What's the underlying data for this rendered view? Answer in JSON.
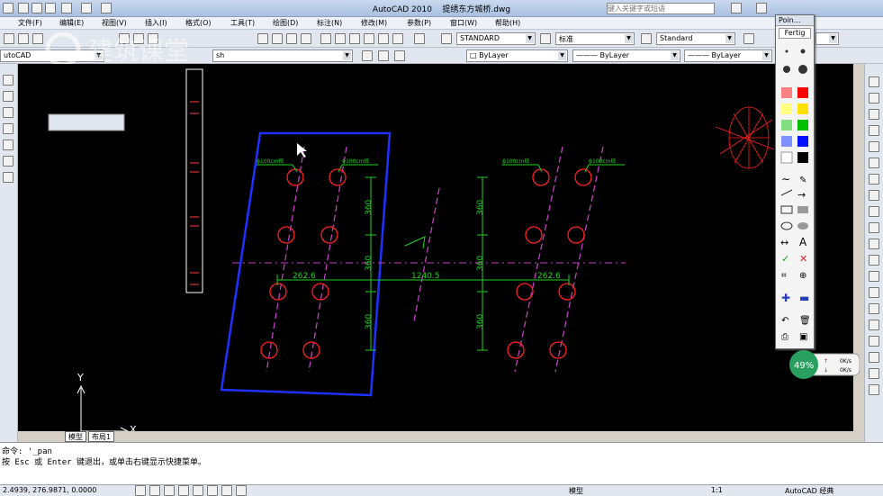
{
  "window": {
    "app": "AutoCAD 2010",
    "file": "提绣东方城桥.dwg",
    "search_placeholder": "键入关键字或短语"
  },
  "menu": [
    "文件(F)",
    "编辑(E)",
    "视图(V)",
    "插入(I)",
    "格式(O)",
    "工具(T)",
    "绘图(D)",
    "标注(N)",
    "修改(M)",
    "参数(P)",
    "窗口(W)",
    "帮助(H)"
  ],
  "toolbar": {
    "text_style": "STANDARD",
    "dim_style": "标准",
    "table_style": "Standard",
    "workspace": "utoCAD",
    "layer_combo": "sh",
    "color": "ByLayer",
    "linetype": "ByLayer",
    "lineweight": "ByLayer"
  },
  "watermark": "建筑课堂",
  "drawing": {
    "labels": [
      "ϕ100cm桩",
      "ϕ100cm桩",
      "ϕ100cm桩",
      "ϕ100cm桩"
    ],
    "dims": [
      "360",
      "360",
      "360",
      "360",
      "360",
      "360",
      "262.6",
      "1240.5",
      "262.6"
    ],
    "axis_x": "X",
    "axis_y": "Y"
  },
  "tabs": {
    "model": "模型",
    "layout": "布局1"
  },
  "command": {
    "line1": "命令: '_pan",
    "line2": "按 Esc 或 Enter 键退出，或单击右键显示快捷菜单。"
  },
  "status": {
    "coords": "2.4939, 276.9871, 0.0000",
    "model": "模型",
    "scale": "1:1",
    "workspace": "AutoCAD 经典"
  },
  "pointer_panel": {
    "title": "Poin...",
    "button": "Fertig"
  },
  "network": {
    "percent": "49%",
    "up": "0K/s",
    "down": "0K/s"
  },
  "colors": {
    "canvas": "#000000",
    "blue": "#2030ff",
    "magenta": "#c040c0",
    "red": "#ff2020",
    "green": "#20d020"
  }
}
